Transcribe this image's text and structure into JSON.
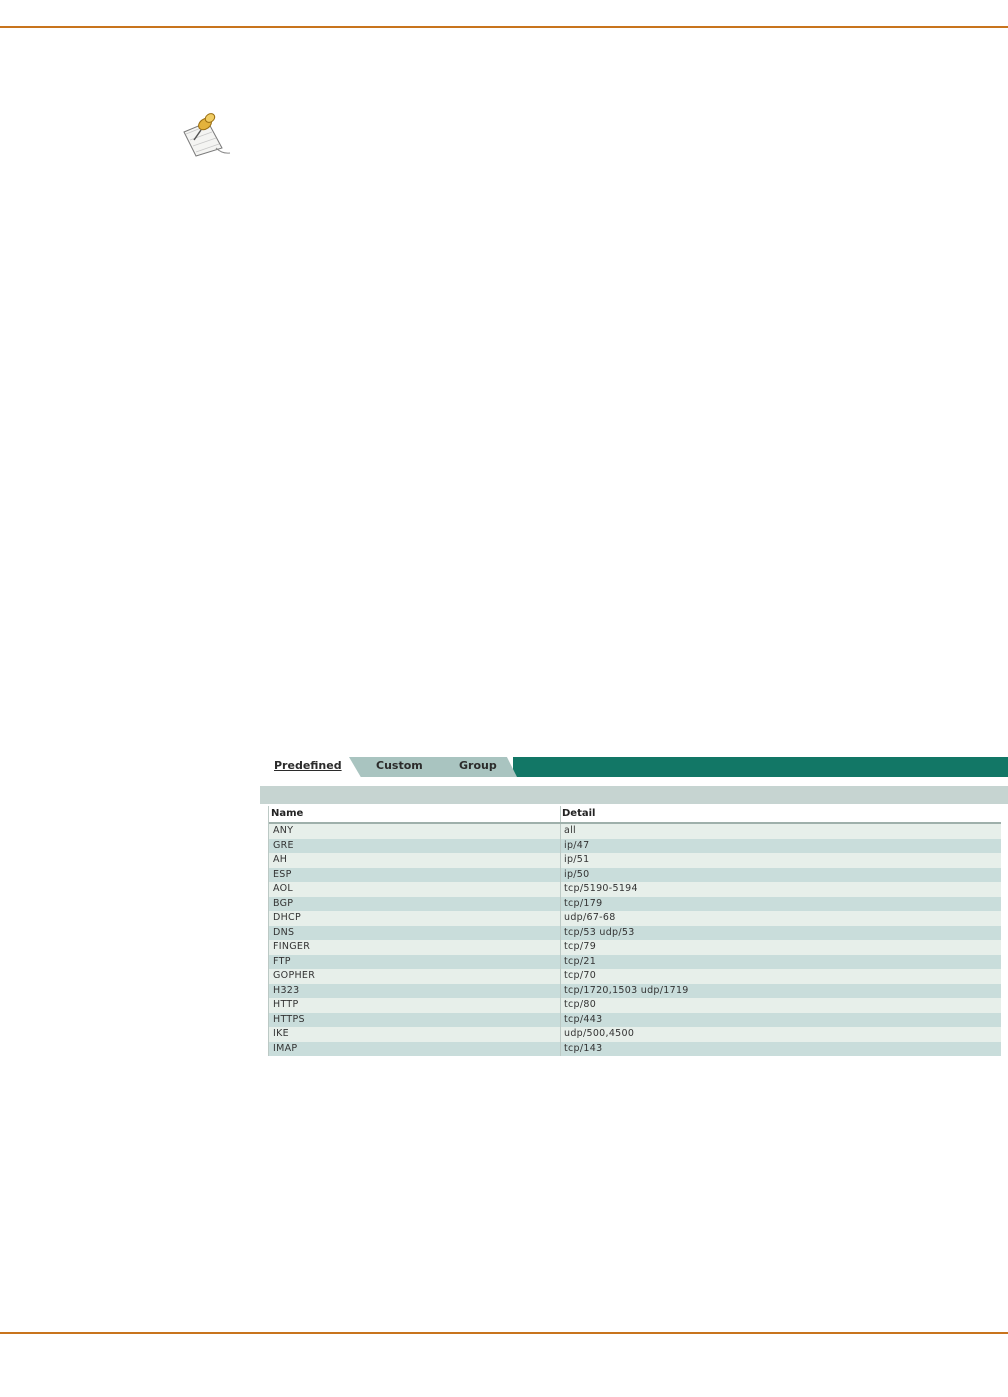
{
  "colors": {
    "rule": "#c8741d",
    "tab_active_bg": "#ffffff",
    "tab_inactive_bg": "#a9c4c0",
    "tab_strip": "#127766",
    "panel_header_bg": "#c6d4d1",
    "row_light": "#e7efea",
    "row_dark": "#c9dddb"
  },
  "icons": {
    "note": "pushpin-note-icon"
  },
  "tabs": [
    {
      "label": "Predefined",
      "active": true
    },
    {
      "label": "Custom",
      "active": false
    },
    {
      "label": "Group",
      "active": false
    }
  ],
  "table": {
    "columns": [
      "Name",
      "Detail"
    ],
    "rows": [
      {
        "name": "ANY",
        "detail": "all"
      },
      {
        "name": "GRE",
        "detail": "ip/47"
      },
      {
        "name": "AH",
        "detail": "ip/51"
      },
      {
        "name": "ESP",
        "detail": "ip/50"
      },
      {
        "name": "AOL",
        "detail": "tcp/5190-5194"
      },
      {
        "name": "BGP",
        "detail": "tcp/179"
      },
      {
        "name": "DHCP",
        "detail": "udp/67-68"
      },
      {
        "name": "DNS",
        "detail": "tcp/53 udp/53"
      },
      {
        "name": "FINGER",
        "detail": "tcp/79"
      },
      {
        "name": "FTP",
        "detail": "tcp/21"
      },
      {
        "name": "GOPHER",
        "detail": "tcp/70"
      },
      {
        "name": "H323",
        "detail": "tcp/1720,1503 udp/1719"
      },
      {
        "name": "HTTP",
        "detail": "tcp/80"
      },
      {
        "name": "HTTPS",
        "detail": "tcp/443"
      },
      {
        "name": "IKE",
        "detail": "udp/500,4500"
      },
      {
        "name": "IMAP",
        "detail": "tcp/143"
      }
    ]
  }
}
